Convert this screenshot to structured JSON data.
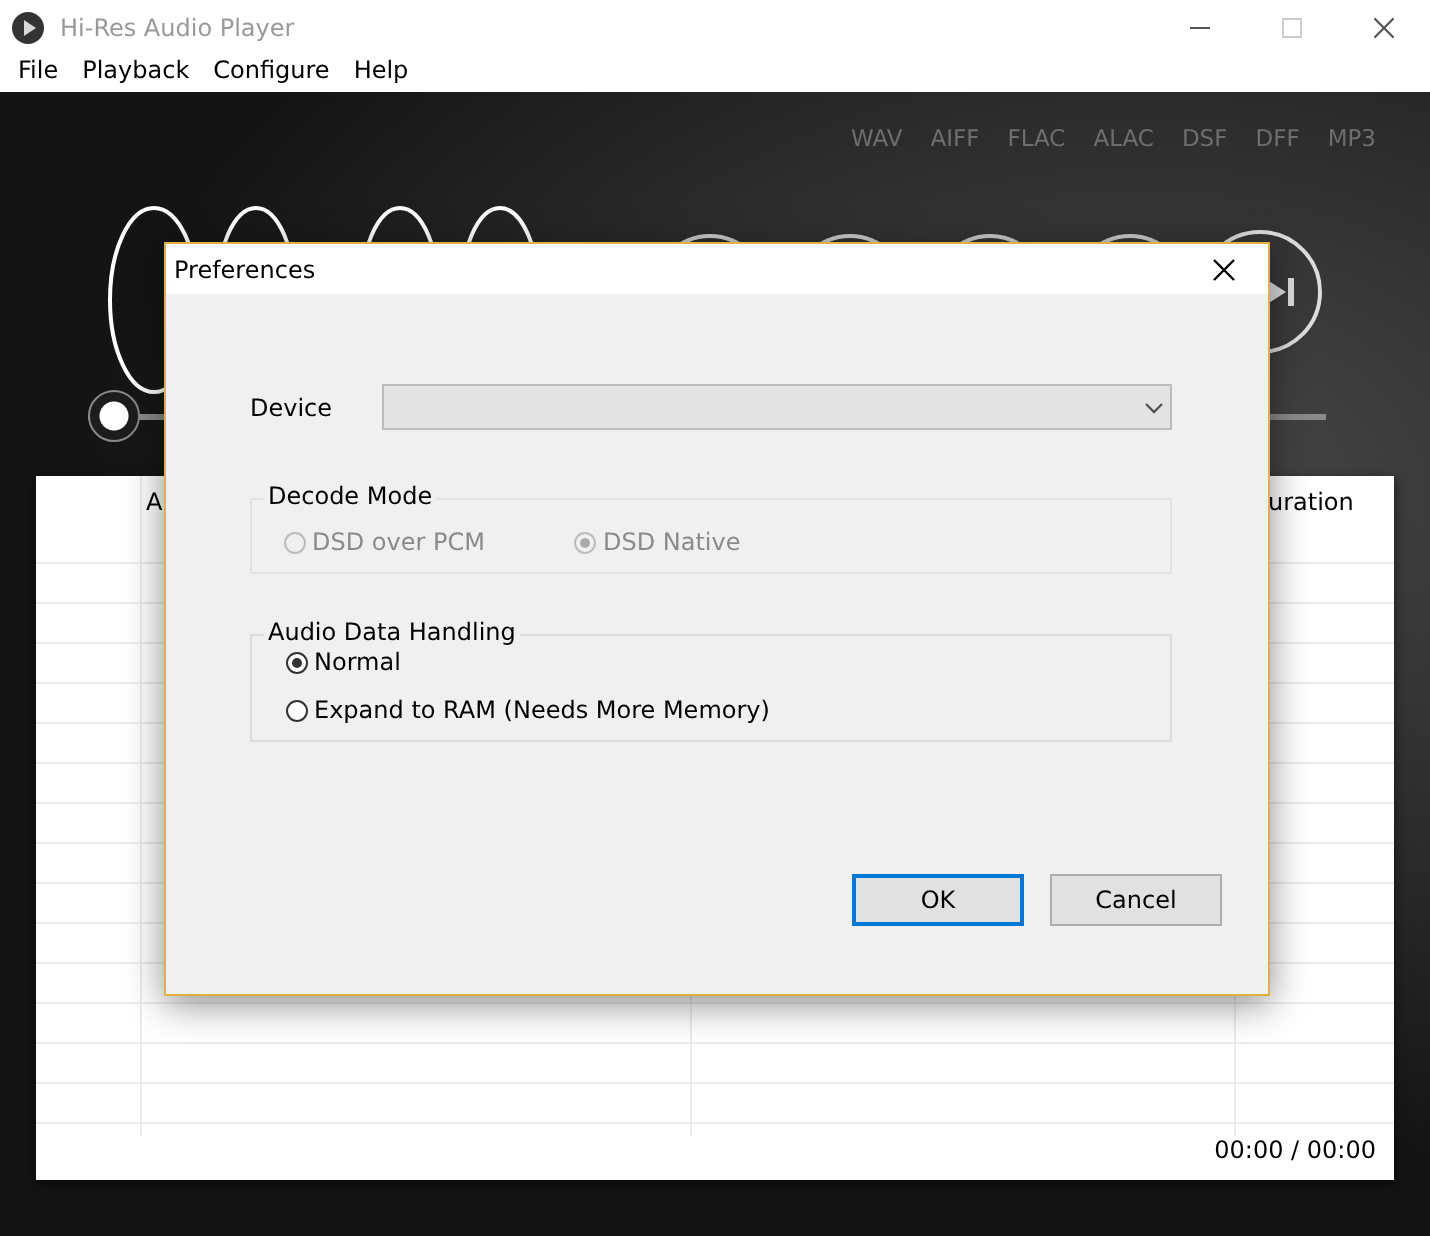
{
  "window": {
    "title": "Hi-Res Audio Player"
  },
  "menu": [
    {
      "label": "File"
    },
    {
      "label": "Playback"
    },
    {
      "label": "Configure"
    },
    {
      "label": "Help"
    }
  ],
  "formats": [
    "WAV",
    "AIFF",
    "FLAC",
    "ALAC",
    "DSF",
    "DFF",
    "MP3"
  ],
  "seek": {
    "level": 0
  },
  "playlist": {
    "column_2": "A",
    "column_4": "uration",
    "time": "00:00 / 00:00"
  },
  "dialog": {
    "title": "Preferences",
    "device": {
      "label": "Device",
      "disabled": true
    },
    "groups": [
      {
        "title": "Decode Mode",
        "kind": "inline",
        "disabled": true,
        "options": [
          {
            "label": "DSD over PCM",
            "selected": false
          },
          {
            "label": "DSD Native",
            "selected": true
          }
        ]
      },
      {
        "title": "Audio Data Handling",
        "kind": "stacked",
        "disabled": false,
        "options": [
          {
            "label": "Normal",
            "selected": true
          },
          {
            "label": "Expand to RAM (Needs More Memory)",
            "selected": false
          }
        ]
      }
    ],
    "buttons": [
      {
        "label": "OK",
        "default": true
      },
      {
        "label": "Cancel",
        "default": false
      }
    ]
  }
}
